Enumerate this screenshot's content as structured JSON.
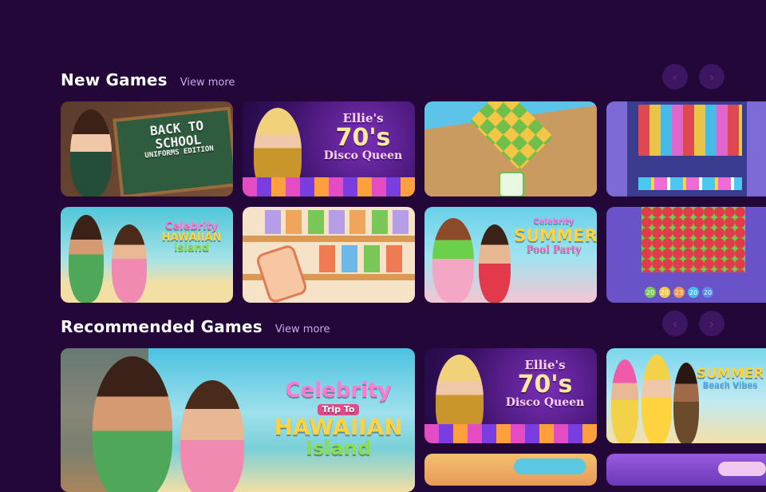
{
  "sections": {
    "new_games": {
      "title": "New Games",
      "view_more": "View more"
    },
    "recommended": {
      "title": "Recommended Games",
      "view_more": "View more"
    }
  },
  "nav": {
    "prev_icon": "chevron-left-icon",
    "next_icon": "chevron-right-icon"
  },
  "tiles": {
    "back_to_school": {
      "line1": "BACK TO",
      "line2": "SCHOOL",
      "line3": "UNIFORMS EDITION"
    },
    "ellies_disco": {
      "line1": "Ellie's",
      "line2": "70's",
      "line3": "Disco Queen"
    },
    "hawaiian": {
      "line1": "Celebrity",
      "line2": "Trip To",
      "line3": "HAWAIIAN",
      "line4": "Island"
    },
    "summer_pool": {
      "line1": "Celebrity",
      "line2": "SUMMER",
      "line3": "Pool Party"
    },
    "summer_beach": {
      "line1": "SUMMER",
      "line2": "Beach Vibes"
    },
    "bubble_numbers": [
      "20",
      "20",
      "23",
      "20",
      "20"
    ]
  },
  "colors": {
    "background": "#220738",
    "accent": "#c7a9ef",
    "arrow": "#3c1660"
  }
}
